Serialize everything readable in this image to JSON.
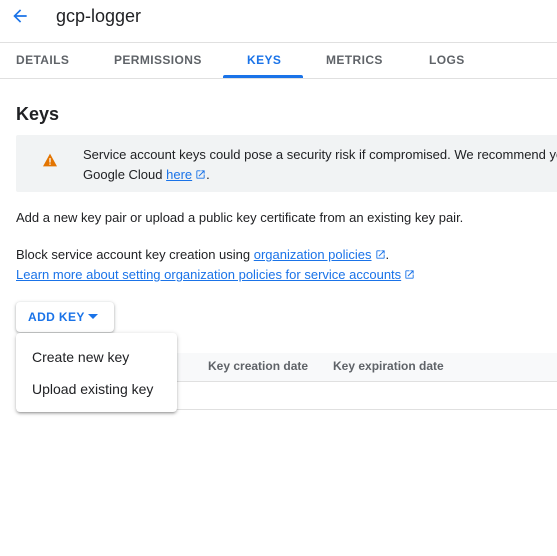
{
  "header": {
    "title": "gcp-logger"
  },
  "tabs": [
    {
      "label": "DETAILS"
    },
    {
      "label": "PERMISSIONS"
    },
    {
      "label": "KEYS",
      "active": true
    },
    {
      "label": "METRICS"
    },
    {
      "label": "LOGS"
    }
  ],
  "section": {
    "title": "Keys"
  },
  "warning": {
    "line1": "Service account keys could pose a security risk if compromised. We recommend you",
    "line2_prefix": "Google Cloud ",
    "link": "here",
    "line2_suffix": "."
  },
  "intro": "Add a new key pair or upload a public key certificate from an existing key pair.",
  "policy": {
    "prefix": "Block service account key creation using ",
    "link": "organization policies",
    "suffix": ".",
    "learn_more": "Learn more about setting organization policies for service accounts"
  },
  "add_key_button": {
    "label": "ADD KEY"
  },
  "dropdown": {
    "items": [
      {
        "label": "Create new key"
      },
      {
        "label": "Upload existing key"
      }
    ]
  },
  "table": {
    "columns": [
      {
        "label": "Key creation date"
      },
      {
        "label": "Key expiration date"
      }
    ]
  },
  "colors": {
    "accent": "#1a73e8",
    "warning": "#e37400",
    "panel": "#f1f3f4",
    "text": "#202124",
    "muted": "#5f6368"
  },
  "icons": {
    "back": "arrow-back-icon",
    "warning": "warning-triangle-icon",
    "external": "open-in-new-icon",
    "dropdown": "caret-down-icon"
  }
}
